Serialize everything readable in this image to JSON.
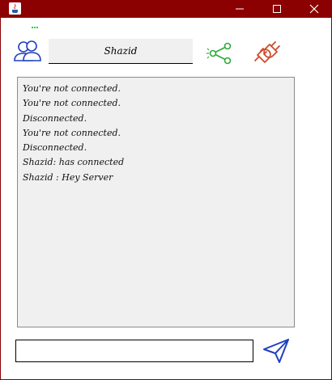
{
  "window": {
    "title_bar_color": "#8b0000",
    "controls": [
      "minimize-icon",
      "maximize-icon",
      "close-icon"
    ]
  },
  "header": {
    "username": "Shazid",
    "icons": [
      "users-icon",
      "share-icon",
      "disconnect-plug-icon"
    ],
    "status_color": "#2ecc40"
  },
  "log": {
    "lines": [
      "You're not connected.",
      "You're not connected.",
      "Disconnected.",
      "You're not connected.",
      "Disconnected.",
      "Shazid: has connected",
      "Shazid : Hey Server"
    ]
  },
  "composer": {
    "message_value": "",
    "send_icon": "send-icon"
  },
  "colors": {
    "accent_blue": "#1d3fbf",
    "share_green": "#2eaa3a",
    "plug_red": "#d04a2a"
  }
}
